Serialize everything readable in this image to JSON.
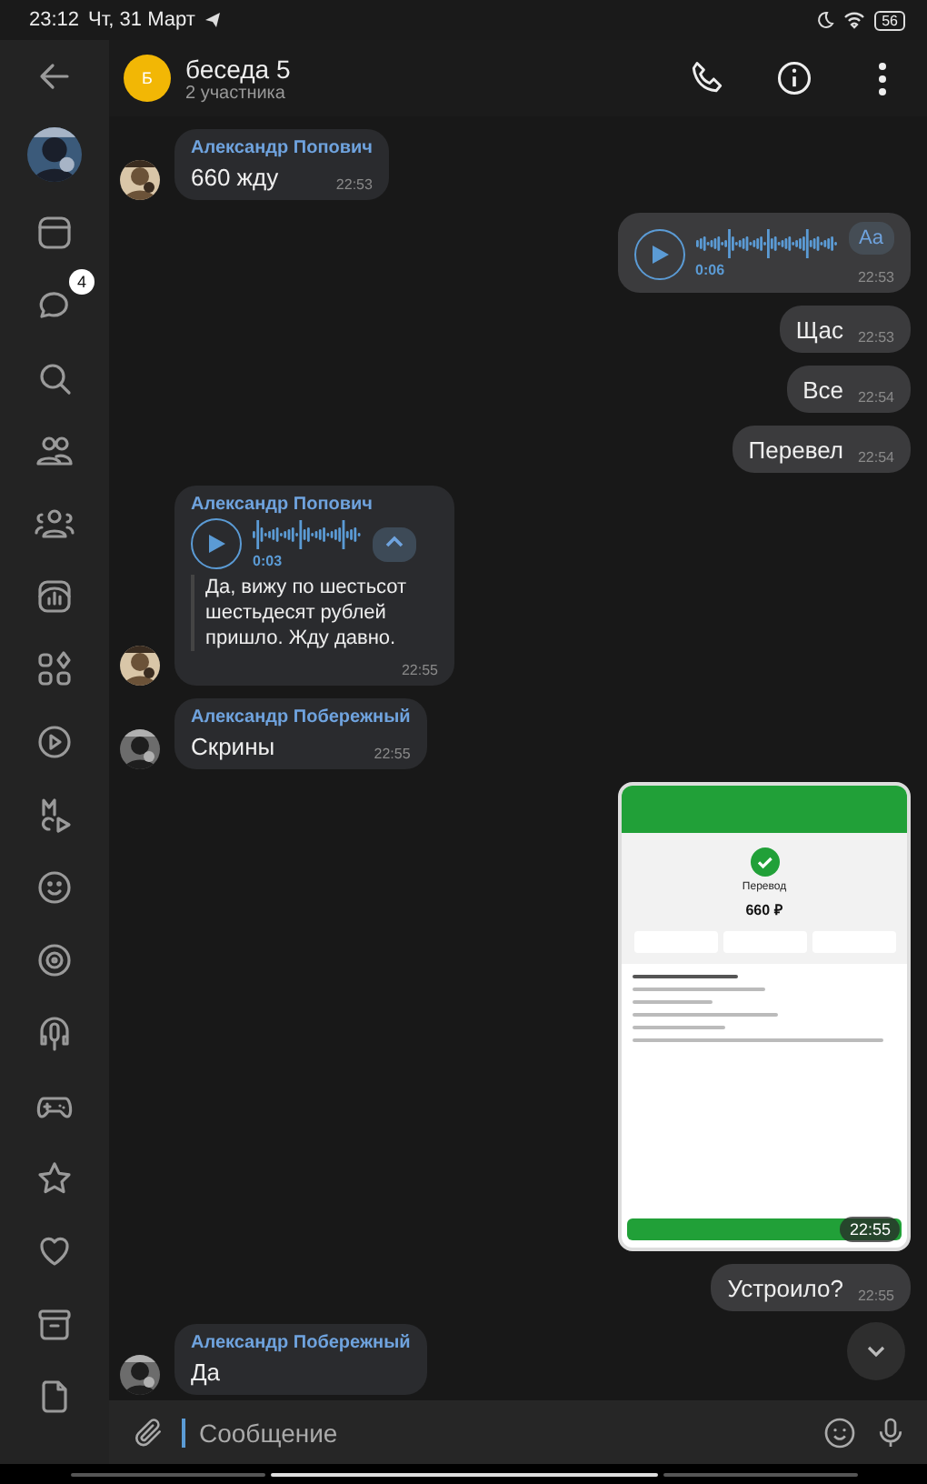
{
  "status_bar": {
    "time": "23:12",
    "date": "Чт, 31 Март",
    "battery": "56"
  },
  "sidebar": {
    "chats_badge": "4"
  },
  "header": {
    "avatar_letter": "Б",
    "title": "беседа 5",
    "subtitle": "2 участника"
  },
  "messages": [
    {
      "kind": "text",
      "outgoing": false,
      "sender": "Александр Попович",
      "text": "660 жду",
      "time": "22:53"
    },
    {
      "kind": "voice",
      "outgoing": true,
      "duration": "0:06",
      "transcribe_button": "Aa",
      "time": "22:53"
    },
    {
      "kind": "text",
      "outgoing": true,
      "text": "Щас",
      "time": "22:53"
    },
    {
      "kind": "text",
      "outgoing": true,
      "text": "Все",
      "time": "22:54"
    },
    {
      "kind": "text",
      "outgoing": true,
      "text": "Перевел",
      "time": "22:54"
    },
    {
      "kind": "voice",
      "outgoing": false,
      "sender": "Александр Попович",
      "duration": "0:03",
      "transcript_expanded": true,
      "transcription": "Да, вижу по шестьсот шестьдесят рублей пришло. Жду давно.",
      "time": "22:55"
    },
    {
      "kind": "text",
      "outgoing": false,
      "sender": "Александр Побережный",
      "text": "Скрины",
      "time": "22:55"
    },
    {
      "outgoing": true,
      "time": "22:55",
      "screenshot": {
        "title": "Перевод",
        "amount": "660 ₽"
      }
    },
    {
      "kind": "text",
      "outgoing": true,
      "text": "Устроило?",
      "time": "22:55"
    },
    {
      "kind": "text",
      "outgoing": false,
      "sender": "Александр Побережный",
      "text": "Да"
    }
  ],
  "composer": {
    "placeholder": "Сообщение"
  }
}
